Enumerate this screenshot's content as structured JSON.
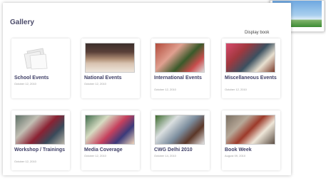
{
  "gallery": {
    "title": "Gallery",
    "display_link": "Display book"
  },
  "cards": [
    {
      "label": "School Events",
      "date": "October 12, 2010",
      "icon": "folder-stack-icon"
    },
    {
      "label": "National Events",
      "date": "October 12, 2010"
    },
    {
      "label": "International Events",
      "date": "October 12, 2010"
    },
    {
      "label": "Miscellaneous Events",
      "date": "October 12, 2010"
    },
    {
      "label": "Workshop / Trainings",
      "date": "October 12, 2010"
    },
    {
      "label": "Media Coverage",
      "date": "October 12, 2010"
    },
    {
      "label": "CWG Delhi 2010",
      "date": "October 14, 2010"
    },
    {
      "label": "Book Week",
      "date": "August 09, 2010"
    }
  ]
}
